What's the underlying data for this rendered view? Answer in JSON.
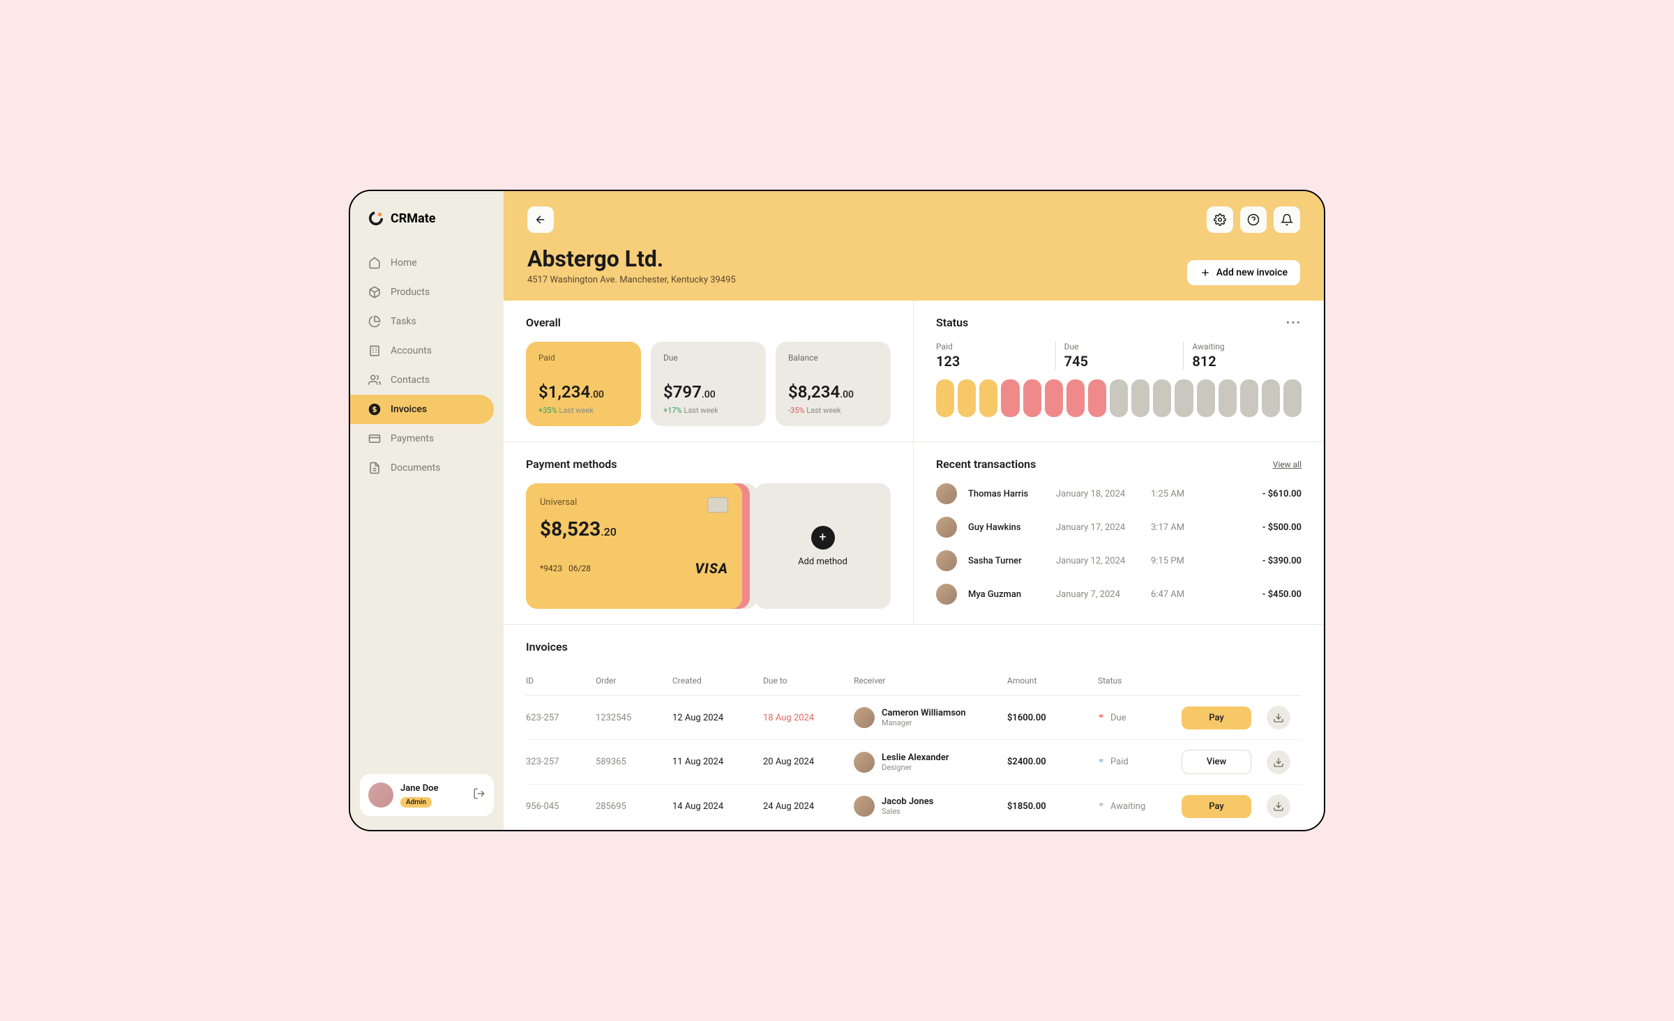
{
  "brand": {
    "name": "CRMate"
  },
  "nav": {
    "items": [
      {
        "label": "Home",
        "icon": "home"
      },
      {
        "label": "Products",
        "icon": "box"
      },
      {
        "label": "Tasks",
        "icon": "pie"
      },
      {
        "label": "Accounts",
        "icon": "building"
      },
      {
        "label": "Contacts",
        "icon": "users"
      },
      {
        "label": "Invoices",
        "icon": "dollar",
        "active": true
      },
      {
        "label": "Payments",
        "icon": "card"
      },
      {
        "label": "Documents",
        "icon": "doc"
      }
    ]
  },
  "user": {
    "name": "Jane Doe",
    "role": "Admin"
  },
  "header": {
    "company": "Abstergo Ltd.",
    "address": "4517 Washington Ave. Manchester, Kentucky 39495",
    "add_label": "Add new invoice"
  },
  "overall": {
    "title": "Overall",
    "cards": [
      {
        "label": "Paid",
        "value": "$1,234",
        "cents": ".00",
        "delta": "+35%",
        "dir": "up",
        "suffix": "Last week"
      },
      {
        "label": "Due",
        "value": "$797",
        "cents": ".00",
        "delta": "+17%",
        "dir": "up",
        "suffix": "Last week"
      },
      {
        "label": "Balance",
        "value": "$8,234",
        "cents": ".00",
        "delta": "-35%",
        "dir": "down",
        "suffix": "Last week"
      }
    ]
  },
  "status": {
    "title": "Status",
    "items": [
      {
        "label": "Paid",
        "value": "123"
      },
      {
        "label": "Due",
        "value": "745"
      },
      {
        "label": "Awaiting",
        "value": "812"
      }
    ],
    "bars": [
      "paid",
      "paid",
      "paid",
      "due",
      "due",
      "due",
      "due",
      "due",
      "await",
      "await",
      "await",
      "await",
      "await",
      "await",
      "await",
      "await",
      "await"
    ]
  },
  "payment": {
    "title": "Payment methods",
    "card": {
      "label": "Universal",
      "balance": "$8,523",
      "cents": ".20",
      "last4": "*9423",
      "exp": "06/28",
      "brand": "VISA"
    },
    "add_label": "Add method"
  },
  "transactions": {
    "title": "Recent transactions",
    "view_all": "View all",
    "rows": [
      {
        "name": "Thomas Harris",
        "date": "January 18, 2024",
        "time": "1:25 AM",
        "amount": "- $610.00"
      },
      {
        "name": "Guy Hawkins",
        "date": "January 17, 2024",
        "time": "3:17 AM",
        "amount": "- $500.00"
      },
      {
        "name": "Sasha Turner",
        "date": "January 12, 2024",
        "time": "9:15 PM",
        "amount": "- $390.00"
      },
      {
        "name": "Mya Guzman",
        "date": "January 7, 2024",
        "time": "6:47 AM",
        "amount": "- $450.00"
      }
    ]
  },
  "invoices": {
    "title": "Invoices",
    "headers": {
      "id": "ID",
      "order": "Order",
      "created": "Created",
      "due": "Due to",
      "receiver": "Receiver",
      "amount": "Amount",
      "status": "Status"
    },
    "rows": [
      {
        "id": "623-257",
        "order": "1232545",
        "created": "12 Aug 2024",
        "due": "18 Aug 2024",
        "overdue": true,
        "receiver": "Cameron Williamson",
        "role": "Manager",
        "amount": "$1600.00",
        "status": "Due",
        "flag": "#f08a8a",
        "action": "Pay"
      },
      {
        "id": "323-257",
        "order": "589365",
        "created": "11 Aug 2024",
        "due": "20 Aug 2024",
        "overdue": false,
        "receiver": "Leslie Alexander",
        "role": "Designer",
        "amount": "$2400.00",
        "status": "Paid",
        "flag": "#a8c5e8",
        "action": "View"
      },
      {
        "id": "956-045",
        "order": "285695",
        "created": "14 Aug 2024",
        "due": "24 Aug 2024",
        "overdue": false,
        "receiver": "Jacob Jones",
        "role": "Sales",
        "amount": "$1850.00",
        "status": "Awaiting",
        "flag": "#c9c7be",
        "action": "Pay"
      }
    ]
  }
}
